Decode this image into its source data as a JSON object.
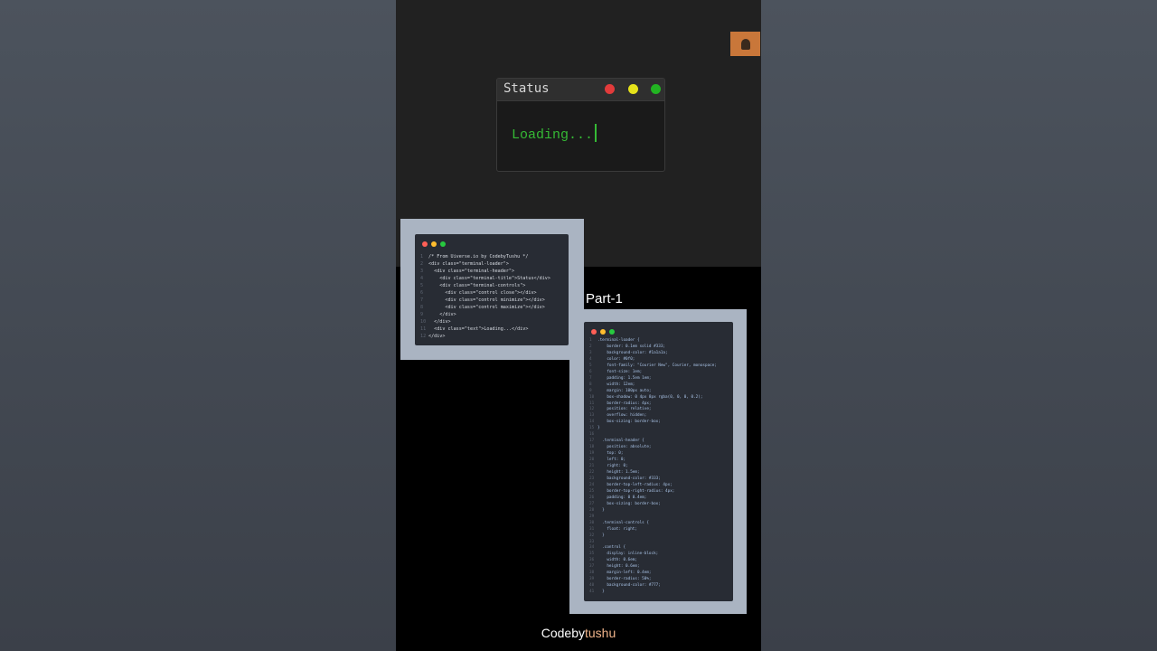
{
  "terminal": {
    "title": "Status",
    "text": "Loading..."
  },
  "html_snippet": {
    "lines": [
      "/* From Uiverse.io by CodebyTushu */",
      "<div class=\"terminal-loader\">",
      "  <div class=\"terminal-header\">",
      "    <div class=\"terminal-title\">Status</div>",
      "    <div class=\"terminal-controls\">",
      "      <div class=\"control close\"></div>",
      "      <div class=\"control minimize\"></div>",
      "      <div class=\"control maximize\"></div>",
      "    </div>",
      "  </div>",
      "  <div class=\"text\">Loading...</div>",
      "</div>"
    ]
  },
  "css_snippet": {
    "lines": [
      ".terminal-loader {",
      "    border: 0.1em solid #333;",
      "    background-color: #1a1a1a;",
      "    color: #0f0;",
      "    font-family: \"Courier New\", Courier, monospace;",
      "    font-size: 1em;",
      "    padding: 1.5em 1em;",
      "    width: 12em;",
      "    margin: 100px auto;",
      "    box-shadow: 0 4px 8px rgba(0, 0, 0, 0.2);",
      "    border-radius: 4px;",
      "    position: relative;",
      "    overflow: hidden;",
      "    box-sizing: border-box;",
      "}",
      "",
      "  .terminal-header {",
      "    position: absolute;",
      "    top: 0;",
      "    left: 0;",
      "    right: 0;",
      "    height: 1.5em;",
      "    background-color: #333;",
      "    border-top-left-radius: 4px;",
      "    border-top-right-radius: 4px;",
      "    padding: 0 0.4em;",
      "    box-sizing: border-box;",
      "  }",
      "",
      "  .terminal-controls {",
      "    float: right;",
      "  }",
      "",
      "  .control {",
      "    display: inline-block;",
      "    width: 0.6em;",
      "    height: 0.6em;",
      "    margin-left: 0.4em;",
      "    border-radius: 50%;",
      "    background-color: #777;",
      "  }"
    ]
  },
  "part_label": "Part-1",
  "watermark": {
    "part1": "Codeby",
    "part2": "tushu"
  },
  "colors": {
    "terminal_green": "#35b935",
    "close": "#e23b3b",
    "minimize": "#e6e21a",
    "maximize": "#22b422",
    "frame": "#aab4c2",
    "editor_bg": "#282c34"
  }
}
